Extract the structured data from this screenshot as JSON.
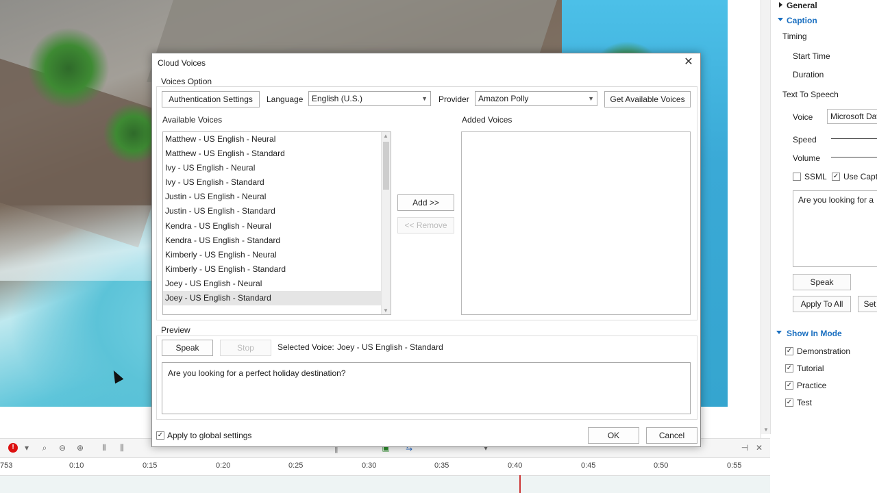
{
  "dialog": {
    "title": "Cloud Voices",
    "voices_option": {
      "title": "Voices Option",
      "auth_button": "Authentication Settings",
      "language_label": "Language",
      "language_value": "English (U.S.)",
      "provider_label": "Provider",
      "provider_value": "Amazon Polly",
      "get_voices_button": "Get Available Voices",
      "available_label": "Available Voices",
      "added_label": "Added Voices",
      "available_voices": [
        "Matthew - US English - Neural",
        "Matthew - US English - Standard",
        "Ivy - US English - Neural",
        "Ivy - US English - Standard",
        "Justin - US English - Neural",
        "Justin - US English - Standard",
        "Kendra - US English - Neural",
        "Kendra - US English - Standard",
        "Kimberly - US English - Neural",
        "Kimberly - US English - Standard",
        "Joey - US English - Neural",
        "Joey - US English - Standard"
      ],
      "selected_index": 11,
      "add_button": "Add >>",
      "remove_button": "<< Remove"
    },
    "preview": {
      "title": "Preview",
      "speak_button": "Speak",
      "stop_button": "Stop",
      "selected_voice_label": "Selected Voice:",
      "selected_voice_value": "Joey - US English - Standard",
      "text": "Are you looking for a perfect holiday destination?"
    },
    "apply_global_label": "Apply to global settings",
    "apply_global_checked": true,
    "ok_button": "OK",
    "cancel_button": "Cancel"
  },
  "properties": {
    "general": "General",
    "caption": "Caption",
    "timing": "Timing",
    "start_time": "Start Time",
    "duration": "Duration",
    "tts": "Text To Speech",
    "voice_label": "Voice",
    "voice_value": "Microsoft Dav",
    "speed_label": "Speed",
    "volume_label": "Volume",
    "ssml_label": "SSML",
    "use_caption_label": "Use Captio",
    "caption_text": "Are you looking for a",
    "speak_button": "Speak",
    "apply_all_button": "Apply To All",
    "set_button": "Set",
    "show_in_mode": "Show In Mode",
    "modes": [
      "Demonstration",
      "Tutorial",
      "Practice",
      "Test"
    ]
  },
  "timeline": {
    "labels": [
      "753",
      "0:10",
      "0:15",
      "0:20",
      "0:25",
      "0:30",
      "0:35",
      "0:40",
      "0:45",
      "0:50",
      "0:55"
    ]
  }
}
